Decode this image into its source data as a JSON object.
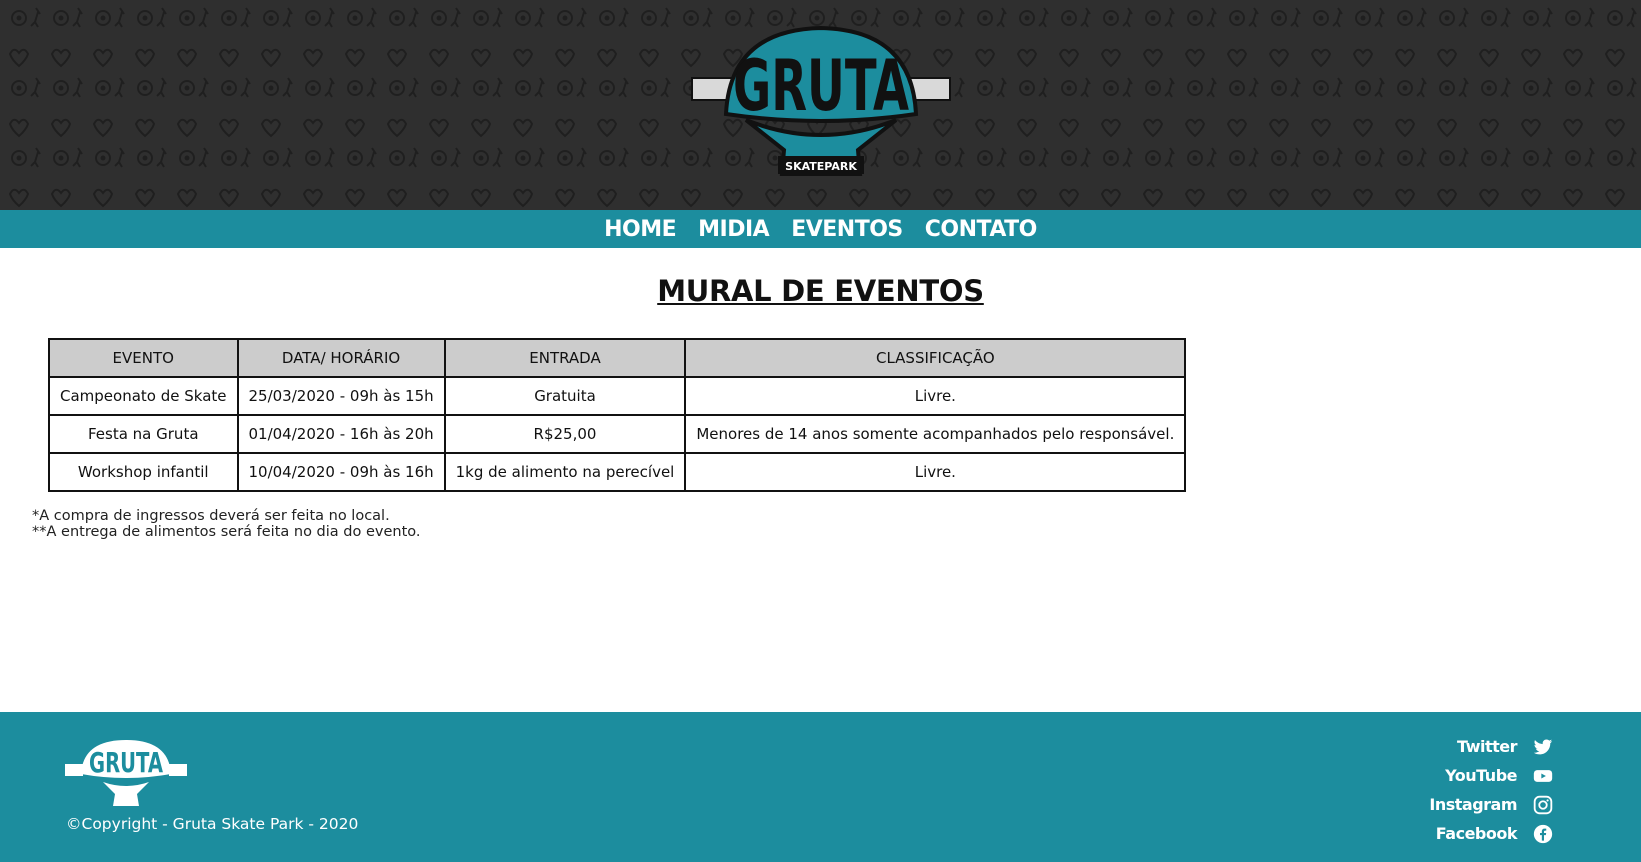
{
  "header": {
    "logo_text": "GRUTA",
    "logo_subtext": "SKATEPARK"
  },
  "nav": {
    "items": [
      "HOME",
      "MIDIA",
      "EVENTOS",
      "CONTATO"
    ]
  },
  "main": {
    "title": "MURAL DE EVENTOS",
    "table": {
      "headers": [
        "EVENTO",
        "DATA/ HORÁRIO",
        "ENTRADA",
        "CLASSIFICAÇÃO"
      ],
      "rows": [
        [
          "Campeonato de Skate",
          "25/03/2020 - 09h às 15h",
          "Gratuita",
          "Livre."
        ],
        [
          "Festa na Gruta",
          "01/04/2020 - 16h às 20h",
          "R$25,00",
          "Menores de 14 anos somente acompanhados pelo responsável."
        ],
        [
          "Workshop infantil",
          "10/04/2020 - 09h às 16h",
          "1kg de alimento na perecível",
          "Livre."
        ]
      ]
    },
    "notes": [
      "*A compra de ingressos deverá ser feita no local.",
      "**A entrega de alimentos será feita no dia do evento."
    ]
  },
  "footer": {
    "logo_text": "GRUTA",
    "copyright": "©Copyright - Gruta Skate Park - 2020",
    "social": [
      {
        "label": "Twitter",
        "icon": "twitter-icon"
      },
      {
        "label": "YouTube",
        "icon": "youtube-icon"
      },
      {
        "label": "Instagram",
        "icon": "instagram-icon"
      },
      {
        "label": "Facebook",
        "icon": "facebook-icon"
      }
    ]
  },
  "colors": {
    "header_bg": "#2f2f2f",
    "accent": "#1c8d9e",
    "table_header_bg": "#cccccc"
  }
}
